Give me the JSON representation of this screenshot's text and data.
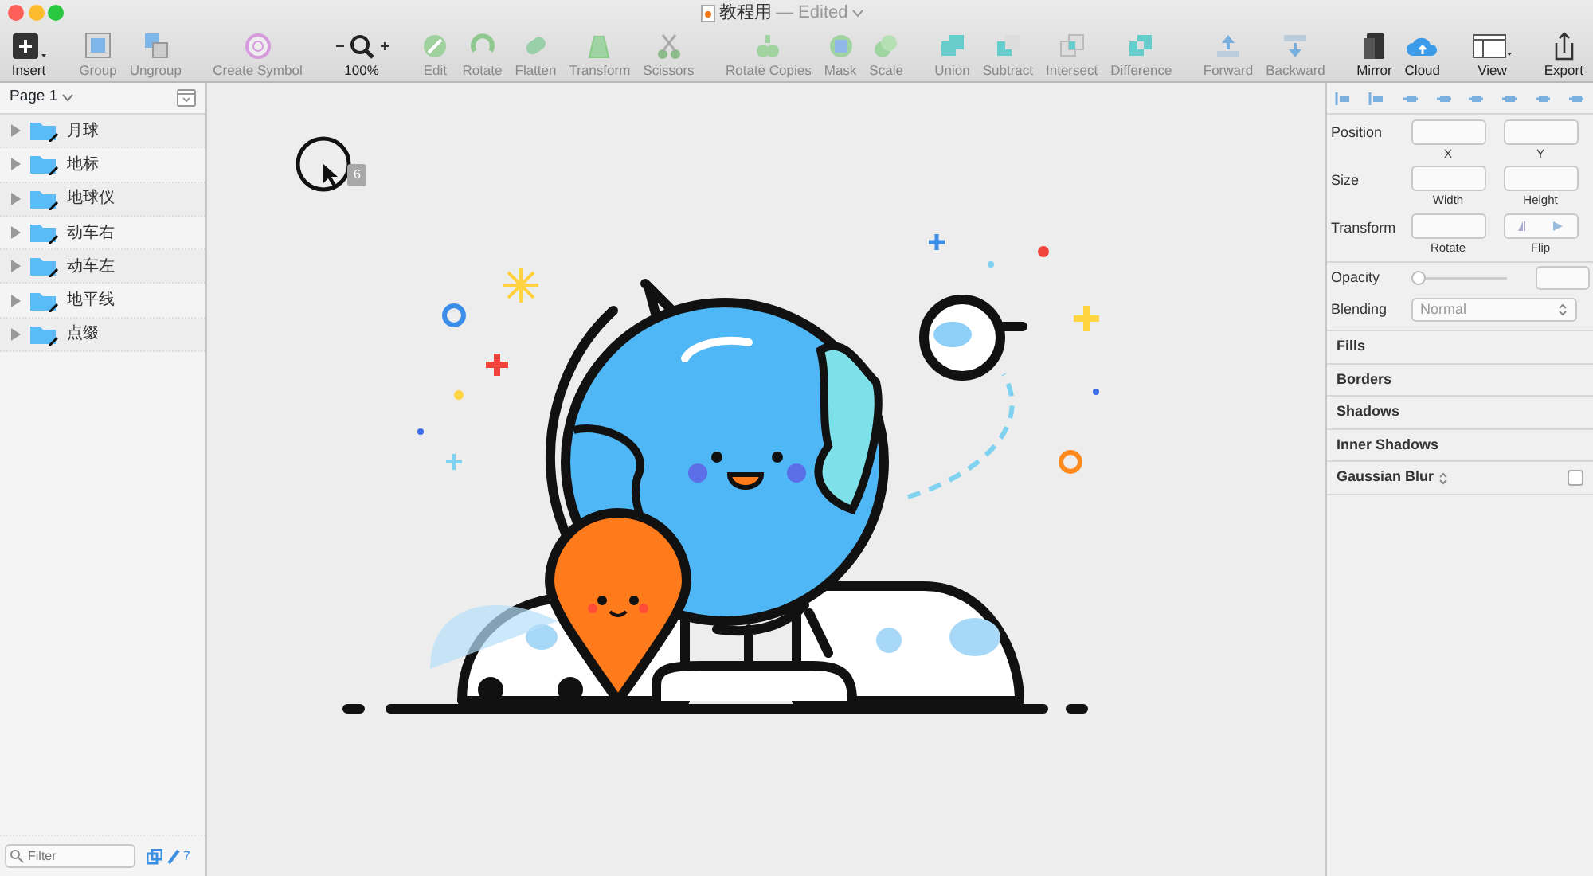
{
  "window": {
    "title": "教程用",
    "status": "— Edited"
  },
  "toolbar": {
    "groups": [
      [
        {
          "label": "Insert",
          "disabled": false
        }
      ],
      [
        {
          "label": "Group",
          "disabled": true
        },
        {
          "label": "Ungroup",
          "disabled": true
        }
      ],
      [
        {
          "label": "Create Symbol",
          "disabled": true
        }
      ],
      [
        {
          "label": "100%",
          "disabled": false,
          "kind": "zoom"
        }
      ],
      [
        {
          "label": "Edit",
          "disabled": true
        },
        {
          "label": "Rotate",
          "disabled": true
        },
        {
          "label": "Flatten",
          "disabled": true
        },
        {
          "label": "Transform",
          "disabled": true
        },
        {
          "label": "Scissors",
          "disabled": true
        }
      ],
      [
        {
          "label": "Rotate Copies",
          "disabled": true
        },
        {
          "label": "Mask",
          "disabled": true
        },
        {
          "label": "Scale",
          "disabled": true
        }
      ],
      [
        {
          "label": "Union",
          "disabled": true
        },
        {
          "label": "Subtract",
          "disabled": true
        },
        {
          "label": "Intersect",
          "disabled": true
        },
        {
          "label": "Difference",
          "disabled": true
        }
      ],
      [
        {
          "label": "Forward",
          "disabled": true
        },
        {
          "label": "Backward",
          "disabled": true
        }
      ],
      [
        {
          "label": "Mirror",
          "disabled": false
        },
        {
          "label": "Cloud",
          "disabled": false
        }
      ],
      [
        {
          "label": "View",
          "disabled": false
        }
      ],
      [
        {
          "label": "Export",
          "disabled": false
        }
      ]
    ]
  },
  "sidebar": {
    "page": "Page 1",
    "layers": [
      {
        "name": "月球",
        "expanded": false
      },
      {
        "name": "地标",
        "expanded": false
      },
      {
        "name": "地球仪",
        "expanded": false
      },
      {
        "name": "动车右",
        "expanded": false
      },
      {
        "name": "动车左",
        "expanded": false
      },
      {
        "name": "地平线",
        "expanded": false
      },
      {
        "name": "点缀",
        "expanded": false
      }
    ],
    "filter": {
      "placeholder": "Filter"
    },
    "count": "7"
  },
  "canvas": {
    "badge": "6"
  },
  "inspector": {
    "position": {
      "label": "Position",
      "fields": [
        "X",
        "Y"
      ]
    },
    "size": {
      "label": "Size",
      "fields": [
        "Width",
        "Height"
      ]
    },
    "transform": {
      "label": "Transform",
      "field": "Rotate",
      "flip": "Flip"
    },
    "opacity": {
      "label": "Opacity",
      "level": 0
    },
    "blending": {
      "label": "Blending",
      "value": "Normal"
    },
    "sections": [
      {
        "label": "Fills"
      },
      {
        "label": "Borders"
      },
      {
        "label": "Shadows"
      },
      {
        "label": "Inner Shadows"
      },
      {
        "label": "Gaussian Blur",
        "kind": "toggle",
        "checked": false
      }
    ]
  }
}
